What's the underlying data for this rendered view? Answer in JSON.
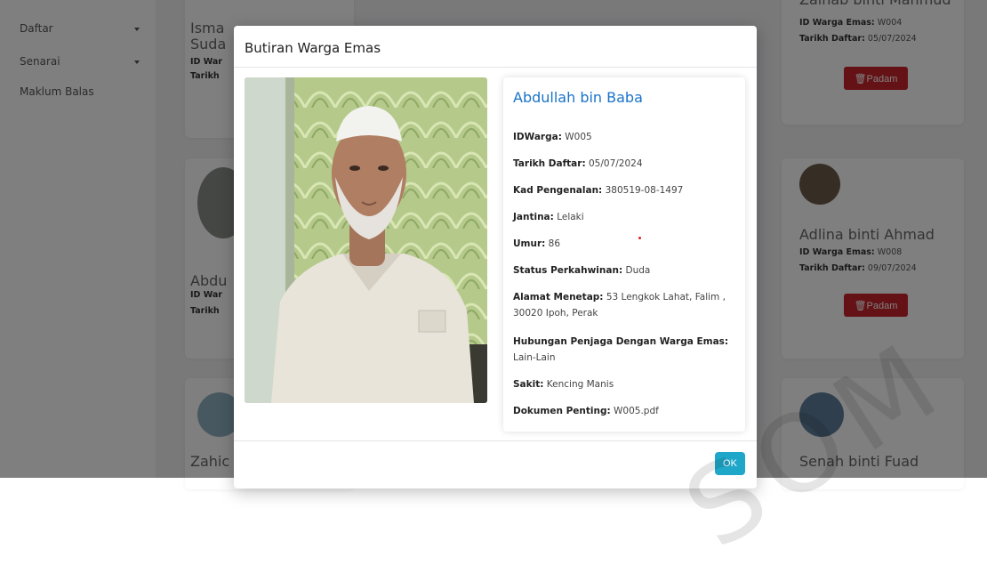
{
  "sidebar": {
    "items": [
      {
        "label": "Daftar"
      },
      {
        "label": "Senarai"
      },
      {
        "label": "Maklum Balas"
      }
    ]
  },
  "background_cards": {
    "top_right": {
      "name": "Zainab binti Mahmud",
      "id_label": "ID Warga Emas:",
      "id_value": "W004",
      "date_label": "Tarikh Daftar:",
      "date_value": "05/07/2024",
      "delete_label": "🗑Padam"
    },
    "mid_right": {
      "name": "Adlina binti Ahmad",
      "id_label": "ID Warga Emas:",
      "id_value": "W008",
      "date_label": "Tarikh Daftar:",
      "date_value": "09/07/2024",
      "delete_label": "🗑Padam"
    },
    "bottom_right": {
      "name": "Senah binti Fuad"
    },
    "left_partials": [
      {
        "name": "Isma",
        "name2": "Suda",
        "l1": "ID War",
        "l2": "Tarikh"
      },
      {
        "name": "Abdu",
        "l1": "ID War",
        "l2": "Tarikh"
      },
      {
        "name": "Zahic"
      }
    ]
  },
  "modal": {
    "title": "Butiran Warga Emas",
    "name": "Abdullah bin Baba",
    "details": [
      {
        "label": "IDWarga:",
        "value": "W005"
      },
      {
        "label": "Tarikh Daftar:",
        "value": "05/07/2024"
      },
      {
        "label": "Kad Pengenalan:",
        "value": "380519-08-1497"
      },
      {
        "label": "Jantina:",
        "value": "Lelaki"
      },
      {
        "label": "Umur:",
        "value": "86"
      },
      {
        "label": "Status Perkahwinan:",
        "value": "Duda"
      },
      {
        "label": "Alamat Menetap:",
        "value": "53 Lengkok Lahat, Falim , 30020 Ipoh, Perak"
      },
      {
        "label": "Hubungan Penjaga Dengan Warga Emas:",
        "value": "Lain-Lain"
      },
      {
        "label": "Sakit:",
        "value": "Kencing Manis"
      },
      {
        "label": "Dokumen Penting:",
        "value": "W005.pdf"
      }
    ],
    "ok_label": "OK"
  },
  "colors": {
    "accent": "#1a73c8",
    "delete": "#c9252c",
    "ok": "#1fa7c9"
  }
}
